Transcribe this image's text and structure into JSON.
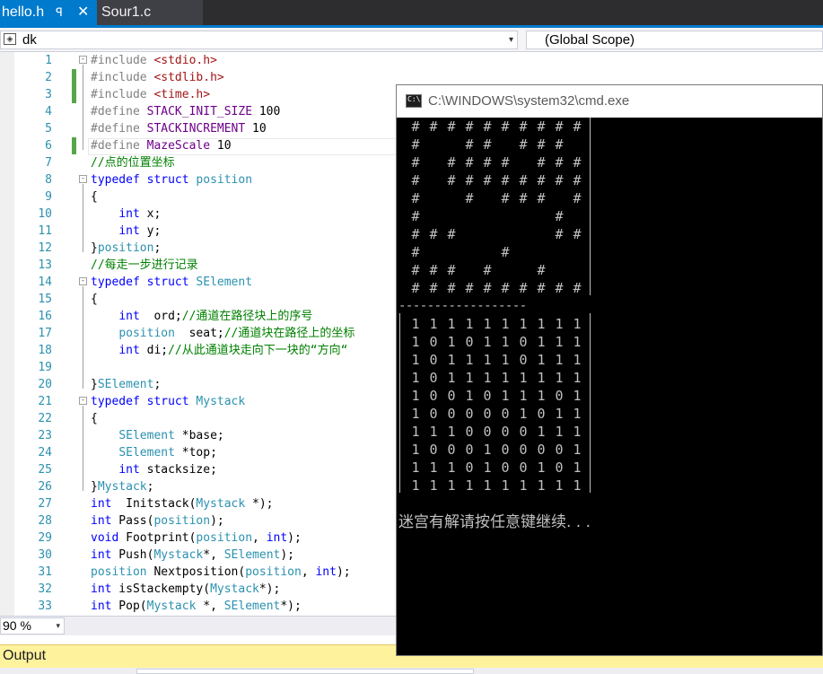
{
  "tabs": [
    {
      "label": "hello.h",
      "pin": "ꟼ",
      "close": "✕",
      "active": true
    },
    {
      "label": "Sour1.c",
      "active": false
    }
  ],
  "nav": {
    "project": "dk",
    "scope": "(Global Scope)",
    "dropdown_arrow": "▾"
  },
  "editor": {
    "lines": [
      {
        "n": "1",
        "fold": "-",
        "tokens": [
          [
            "pp",
            "#include "
          ],
          [
            "str",
            "<stdio.h>"
          ]
        ]
      },
      {
        "n": "2",
        "changed": true,
        "tokens": [
          [
            "pp",
            "#include "
          ],
          [
            "str",
            "<stdlib.h>"
          ]
        ]
      },
      {
        "n": "3",
        "changed": true,
        "tokens": [
          [
            "pp",
            "#include "
          ],
          [
            "str",
            "<time.h>"
          ]
        ]
      },
      {
        "n": "4",
        "tokens": [
          [
            "pp",
            "#define "
          ],
          [
            "mac",
            "STACK_INIT_SIZE"
          ],
          [
            "pl",
            " 100"
          ]
        ]
      },
      {
        "n": "5",
        "tokens": [
          [
            "pp",
            "#define "
          ],
          [
            "mac",
            "STACKINCREMENT"
          ],
          [
            "pl",
            " 10"
          ]
        ]
      },
      {
        "n": "6",
        "changed": true,
        "tokens": [
          [
            "pp",
            "#define "
          ],
          [
            "mac",
            "MazeScale"
          ],
          [
            "pl",
            " 10"
          ]
        ]
      },
      {
        "n": "7",
        "tokens": [
          [
            "cm",
            "//点的位置坐标"
          ]
        ]
      },
      {
        "n": "8",
        "fold": "-",
        "tokens": [
          [
            "kw",
            "typedef"
          ],
          [
            "pl",
            " "
          ],
          [
            "kw",
            "struct"
          ],
          [
            "pl",
            " "
          ],
          [
            "ty",
            "position"
          ]
        ]
      },
      {
        "n": "9",
        "tokens": [
          [
            "pl",
            "{"
          ]
        ]
      },
      {
        "n": "10",
        "tokens": [
          [
            "pl",
            "    "
          ],
          [
            "kw",
            "int"
          ],
          [
            "pl",
            " x;"
          ]
        ]
      },
      {
        "n": "11",
        "tokens": [
          [
            "pl",
            "    "
          ],
          [
            "kw",
            "int"
          ],
          [
            "pl",
            " y;"
          ]
        ]
      },
      {
        "n": "12",
        "tokens": [
          [
            "pl",
            "}"
          ],
          [
            "ty",
            "position"
          ],
          [
            "pl",
            ";"
          ]
        ]
      },
      {
        "n": "13",
        "tokens": [
          [
            "cm",
            "//每走一步进行记录"
          ]
        ]
      },
      {
        "n": "14",
        "fold": "-",
        "tokens": [
          [
            "kw",
            "typedef"
          ],
          [
            "pl",
            " "
          ],
          [
            "kw",
            "struct"
          ],
          [
            "pl",
            " "
          ],
          [
            "ty",
            "SElement"
          ]
        ]
      },
      {
        "n": "15",
        "tokens": [
          [
            "pl",
            "{"
          ]
        ]
      },
      {
        "n": "16",
        "tokens": [
          [
            "pl",
            "    "
          ],
          [
            "kw",
            "int"
          ],
          [
            "pl",
            "  ord;"
          ],
          [
            "cm",
            "//通道在路径块上的序号"
          ]
        ]
      },
      {
        "n": "17",
        "tokens": [
          [
            "pl",
            "    "
          ],
          [
            "ty",
            "position"
          ],
          [
            "pl",
            "  seat;"
          ],
          [
            "cm",
            "//通道块在路径上的坐标"
          ]
        ]
      },
      {
        "n": "18",
        "tokens": [
          [
            "pl",
            "    "
          ],
          [
            "kw",
            "int"
          ],
          [
            "pl",
            " di;"
          ],
          [
            "cm",
            "//从此通道块走向下一块的“方向“"
          ]
        ]
      },
      {
        "n": "19",
        "tokens": []
      },
      {
        "n": "20",
        "tokens": [
          [
            "pl",
            "}"
          ],
          [
            "ty",
            "SElement"
          ],
          [
            "pl",
            ";"
          ]
        ]
      },
      {
        "n": "21",
        "fold": "-",
        "tokens": [
          [
            "kw",
            "typedef"
          ],
          [
            "pl",
            " "
          ],
          [
            "kw",
            "struct"
          ],
          [
            "pl",
            " "
          ],
          [
            "ty",
            "Mystack"
          ]
        ]
      },
      {
        "n": "22",
        "tokens": [
          [
            "pl",
            "{"
          ]
        ]
      },
      {
        "n": "23",
        "tokens": [
          [
            "pl",
            "    "
          ],
          [
            "ty",
            "SElement"
          ],
          [
            "pl",
            " *base;"
          ]
        ]
      },
      {
        "n": "24",
        "tokens": [
          [
            "pl",
            "    "
          ],
          [
            "ty",
            "SElement"
          ],
          [
            "pl",
            " *top;"
          ]
        ]
      },
      {
        "n": "25",
        "tokens": [
          [
            "pl",
            "    "
          ],
          [
            "kw",
            "int"
          ],
          [
            "pl",
            " stacksize;"
          ]
        ]
      },
      {
        "n": "26",
        "tokens": [
          [
            "pl",
            "}"
          ],
          [
            "ty",
            "Mystack"
          ],
          [
            "pl",
            ";"
          ]
        ]
      },
      {
        "n": "27",
        "tokens": [
          [
            "kw",
            "int"
          ],
          [
            "pl",
            "  Initstack("
          ],
          [
            "ty",
            "Mystack"
          ],
          [
            "pl",
            " *);"
          ]
        ]
      },
      {
        "n": "28",
        "tokens": [
          [
            "kw",
            "int"
          ],
          [
            "pl",
            " Pass("
          ],
          [
            "ty",
            "position"
          ],
          [
            "pl",
            ");"
          ]
        ]
      },
      {
        "n": "29",
        "tokens": [
          [
            "kw",
            "void"
          ],
          [
            "pl",
            " Footprint("
          ],
          [
            "ty",
            "position"
          ],
          [
            "pl",
            ", "
          ],
          [
            "kw",
            "int"
          ],
          [
            "pl",
            ");"
          ]
        ]
      },
      {
        "n": "30",
        "tokens": [
          [
            "kw",
            "int"
          ],
          [
            "pl",
            " Push("
          ],
          [
            "ty",
            "Mystack"
          ],
          [
            "pl",
            "*, "
          ],
          [
            "ty",
            "SElement"
          ],
          [
            "pl",
            ");"
          ]
        ]
      },
      {
        "n": "31",
        "tokens": [
          [
            "ty",
            "position"
          ],
          [
            "pl",
            " Nextposition("
          ],
          [
            "ty",
            "position"
          ],
          [
            "pl",
            ", "
          ],
          [
            "kw",
            "int"
          ],
          [
            "pl",
            ");"
          ]
        ]
      },
      {
        "n": "32",
        "tokens": [
          [
            "kw",
            "int"
          ],
          [
            "pl",
            " isStackempty("
          ],
          [
            "ty",
            "Mystack"
          ],
          [
            "pl",
            "*);"
          ]
        ]
      },
      {
        "n": "33",
        "tokens": [
          [
            "kw",
            "int"
          ],
          [
            "pl",
            " Pop("
          ],
          [
            "ty",
            "Mystack"
          ],
          [
            "pl",
            " *, "
          ],
          [
            "ty",
            "SElement"
          ],
          [
            "pl",
            "*);"
          ]
        ]
      }
    ]
  },
  "zoom": {
    "value": "90 %",
    "arrow": "▾"
  },
  "output_label": "Output",
  "console": {
    "title": "C:\\WINDOWS\\system32\\cmd.exe",
    "icon_text": "C:\\",
    "maze": [
      "##########",
      "#  ## ###",
      "# #### ###",
      "# ########",
      "#  # ### #",
      "#       # ##",
      "###     ###",
      "#    #    #",
      "### #  #  #",
      "##########"
    ],
    "separator": "------------------",
    "matrix": [
      "1111111111",
      "1010110111",
      "1011110111",
      "1011111111",
      "1001011101",
      "1000001011",
      "1110000111",
      "1000100001",
      "1110100101",
      "1111111111"
    ],
    "message": "迷宫有解请按任意键继续. . ."
  }
}
